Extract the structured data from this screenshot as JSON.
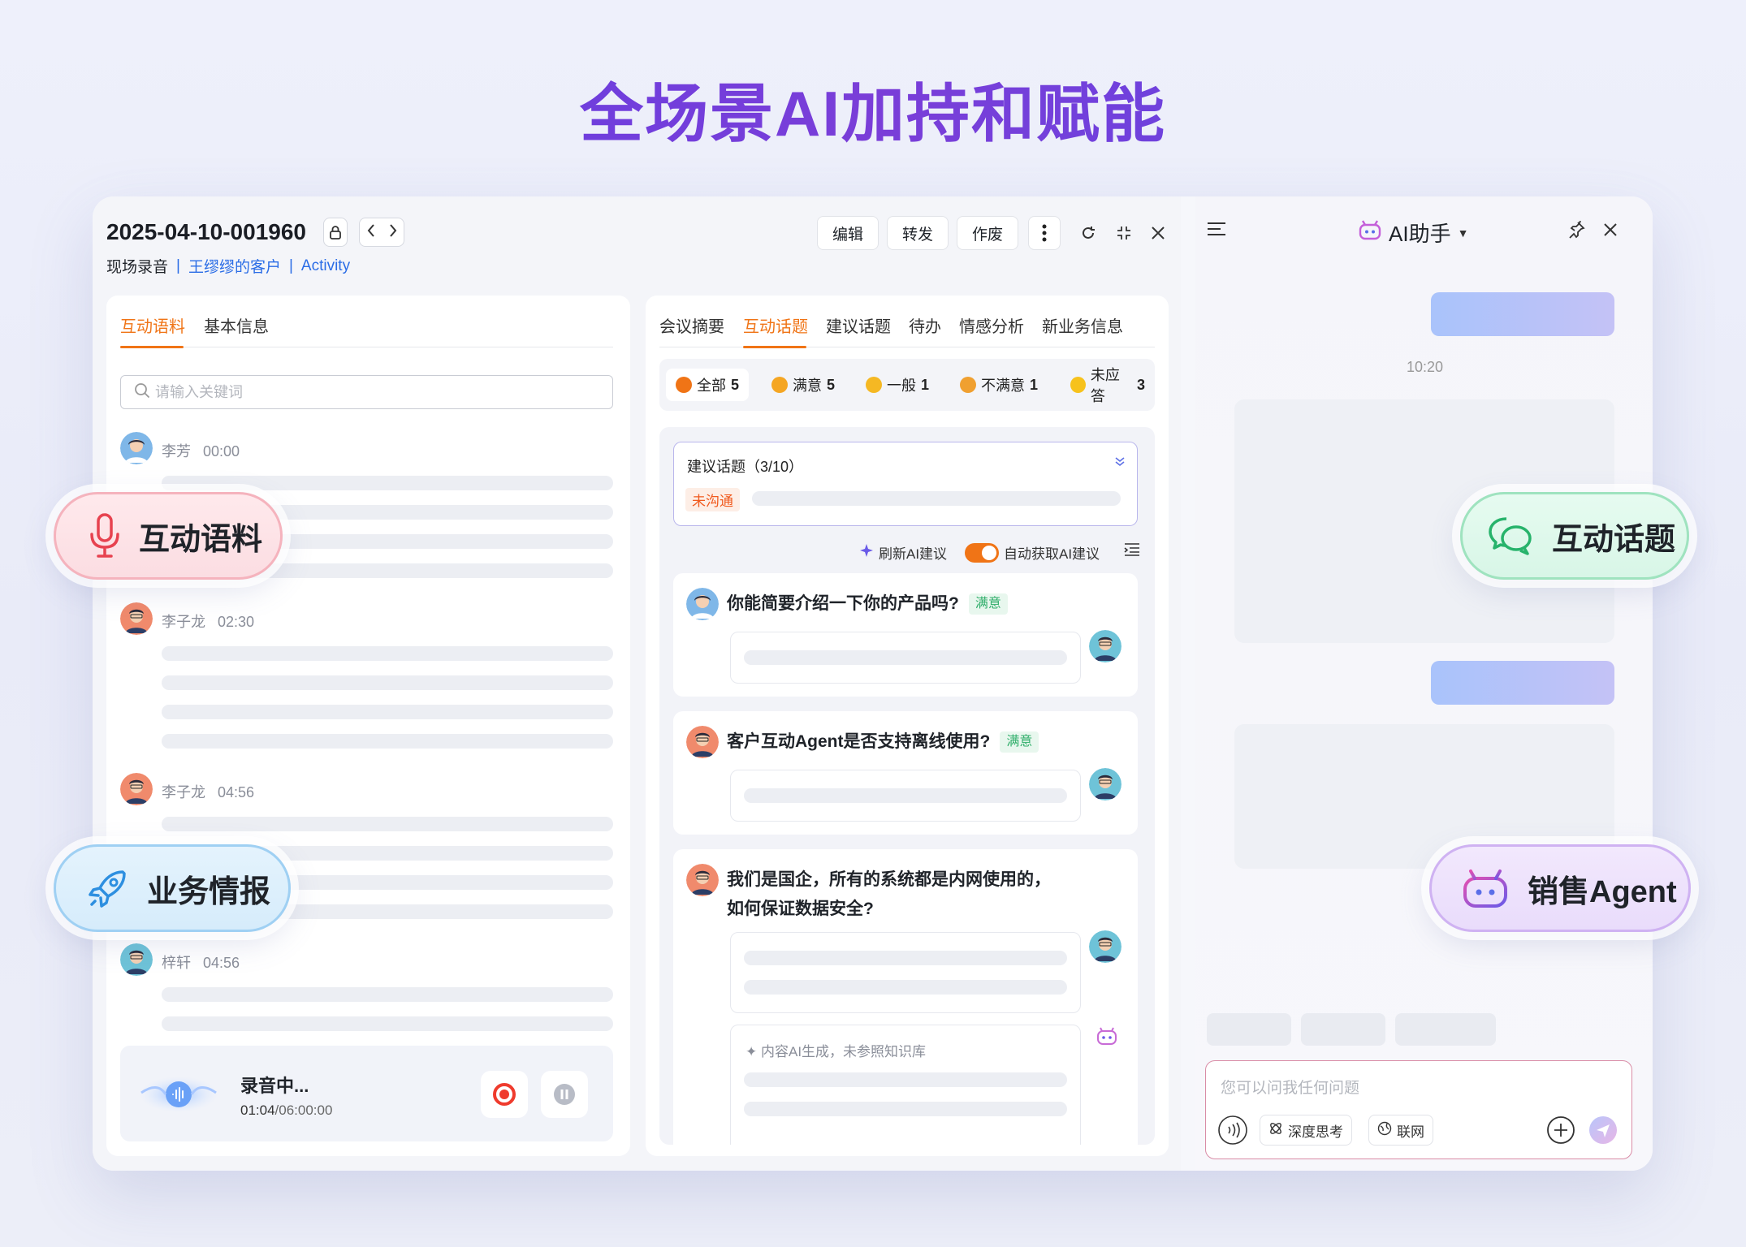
{
  "hero": {
    "title": "全场景AI加持和赋能"
  },
  "header": {
    "doc_id": "2025-04-10-001960",
    "breadcrumb": [
      "现场录音",
      "王缪缪的客户",
      "Activity"
    ],
    "buttons": {
      "edit": "编辑",
      "forward": "转发",
      "void": "作废"
    }
  },
  "left": {
    "tabs": [
      "互动语料",
      "基本信息"
    ],
    "search_placeholder": "请输入关键词",
    "entries": [
      {
        "speaker": "李芳",
        "time": "00:00"
      },
      {
        "speaker": "李子龙",
        "time": "02:30"
      },
      {
        "speaker": "李子龙",
        "time": "04:56"
      },
      {
        "speaker": "梓轩",
        "time": "04:56"
      }
    ],
    "recording": {
      "title": "录音中...",
      "elapsed": "01:04",
      "total": "/06:00:00"
    }
  },
  "middle": {
    "tabs": [
      "会议摘要",
      "互动话题",
      "建议话题",
      "待办",
      "情感分析",
      "新业务信息"
    ],
    "filters": [
      {
        "label": "全部",
        "count": "5",
        "color": "#f07416"
      },
      {
        "label": "满意",
        "count": "5",
        "color": "#f5a623"
      },
      {
        "label": "一般",
        "count": "1",
        "color": "#f5b823"
      },
      {
        "label": "不满意",
        "count": "1",
        "color": "#f0a030"
      },
      {
        "label": "未应答",
        "count": "3",
        "color": "#f7c21c"
      }
    ],
    "suggest": {
      "title": "建议话题（3/10）",
      "status": "未沟通"
    },
    "refresh_label": "刷新AI建议",
    "auto_label": "自动获取AI建议",
    "questions": [
      {
        "text": "你能简要介绍一下你的产品吗?",
        "tag": "满意"
      },
      {
        "text": "客户互动Agent是否支持离线使用?",
        "tag": "满意"
      },
      {
        "text_line1": "我们是国企，所有的系统都是内网使用的，",
        "text_line2": "如何保证数据安全?"
      }
    ],
    "ai_note": "内容AI生成，未参照知识库"
  },
  "ai_panel": {
    "title": "AI助手",
    "time": "10:20",
    "input_placeholder": "您可以问我任何问题",
    "deep_think": "深度思考",
    "web": "联网"
  },
  "badges": {
    "corpus": "互动语料",
    "topics": "互动话题",
    "business": "业务情报",
    "agent": "销售Agent"
  },
  "colors": {
    "accent": "#f07416",
    "brand": "#6a3de0",
    "link": "#2b6de6"
  }
}
